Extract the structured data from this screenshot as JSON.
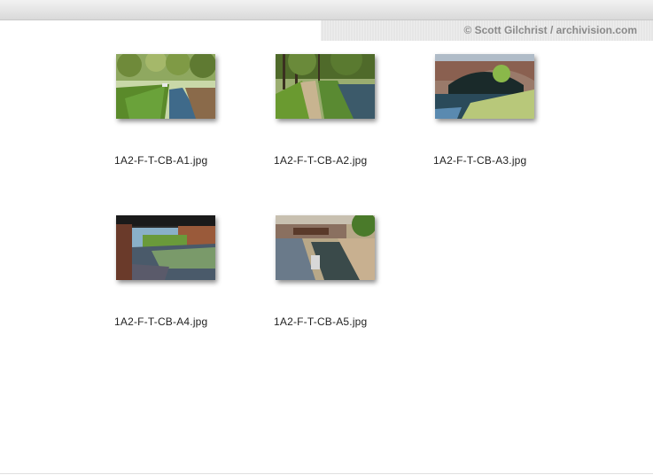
{
  "header": {
    "credit": "© Scott Gilchrist / archivision.com"
  },
  "gallery": {
    "items": [
      {
        "filename": "1A2-F-T-CB-A1.jpg",
        "thumbnail_icon": "canal-tree-lined-towpath-photo"
      },
      {
        "filename": "1A2-F-T-CB-A2.jpg",
        "thumbnail_icon": "canal-path-with-trees-photo"
      },
      {
        "filename": "1A2-F-T-CB-A3.jpg",
        "thumbnail_icon": "canal-stone-bridge-photo"
      },
      {
        "filename": "1A2-F-T-CB-A4.jpg",
        "thumbnail_icon": "canal-under-bridge-photo"
      },
      {
        "filename": "1A2-F-T-CB-A5.jpg",
        "thumbnail_icon": "canal-lock-photo"
      }
    ]
  }
}
